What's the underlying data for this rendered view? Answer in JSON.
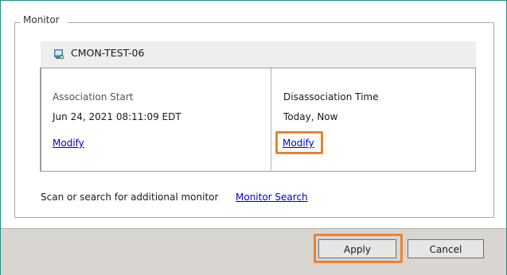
{
  "monitor_group": {
    "legend": "Monitor",
    "device": {
      "name": "CMON-TEST-06",
      "icon": "monitor-device-icon"
    },
    "association": {
      "label": "Association Start",
      "value": "Jun 24, 2021 08:11:09 EDT",
      "modify_label": "Modify"
    },
    "disassociation": {
      "label": "Disassociation Time",
      "value": "Today, Now",
      "modify_label": "Modify"
    },
    "scan_text": "Scan or search for additional monitor",
    "search_link": "Monitor Search"
  },
  "footer": {
    "apply_label": "Apply",
    "cancel_label": "Cancel"
  },
  "colors": {
    "highlight": "#e98332",
    "link": "#0000cc",
    "footer_bg": "#d9d6d2",
    "window_border": "#2a8a83"
  }
}
